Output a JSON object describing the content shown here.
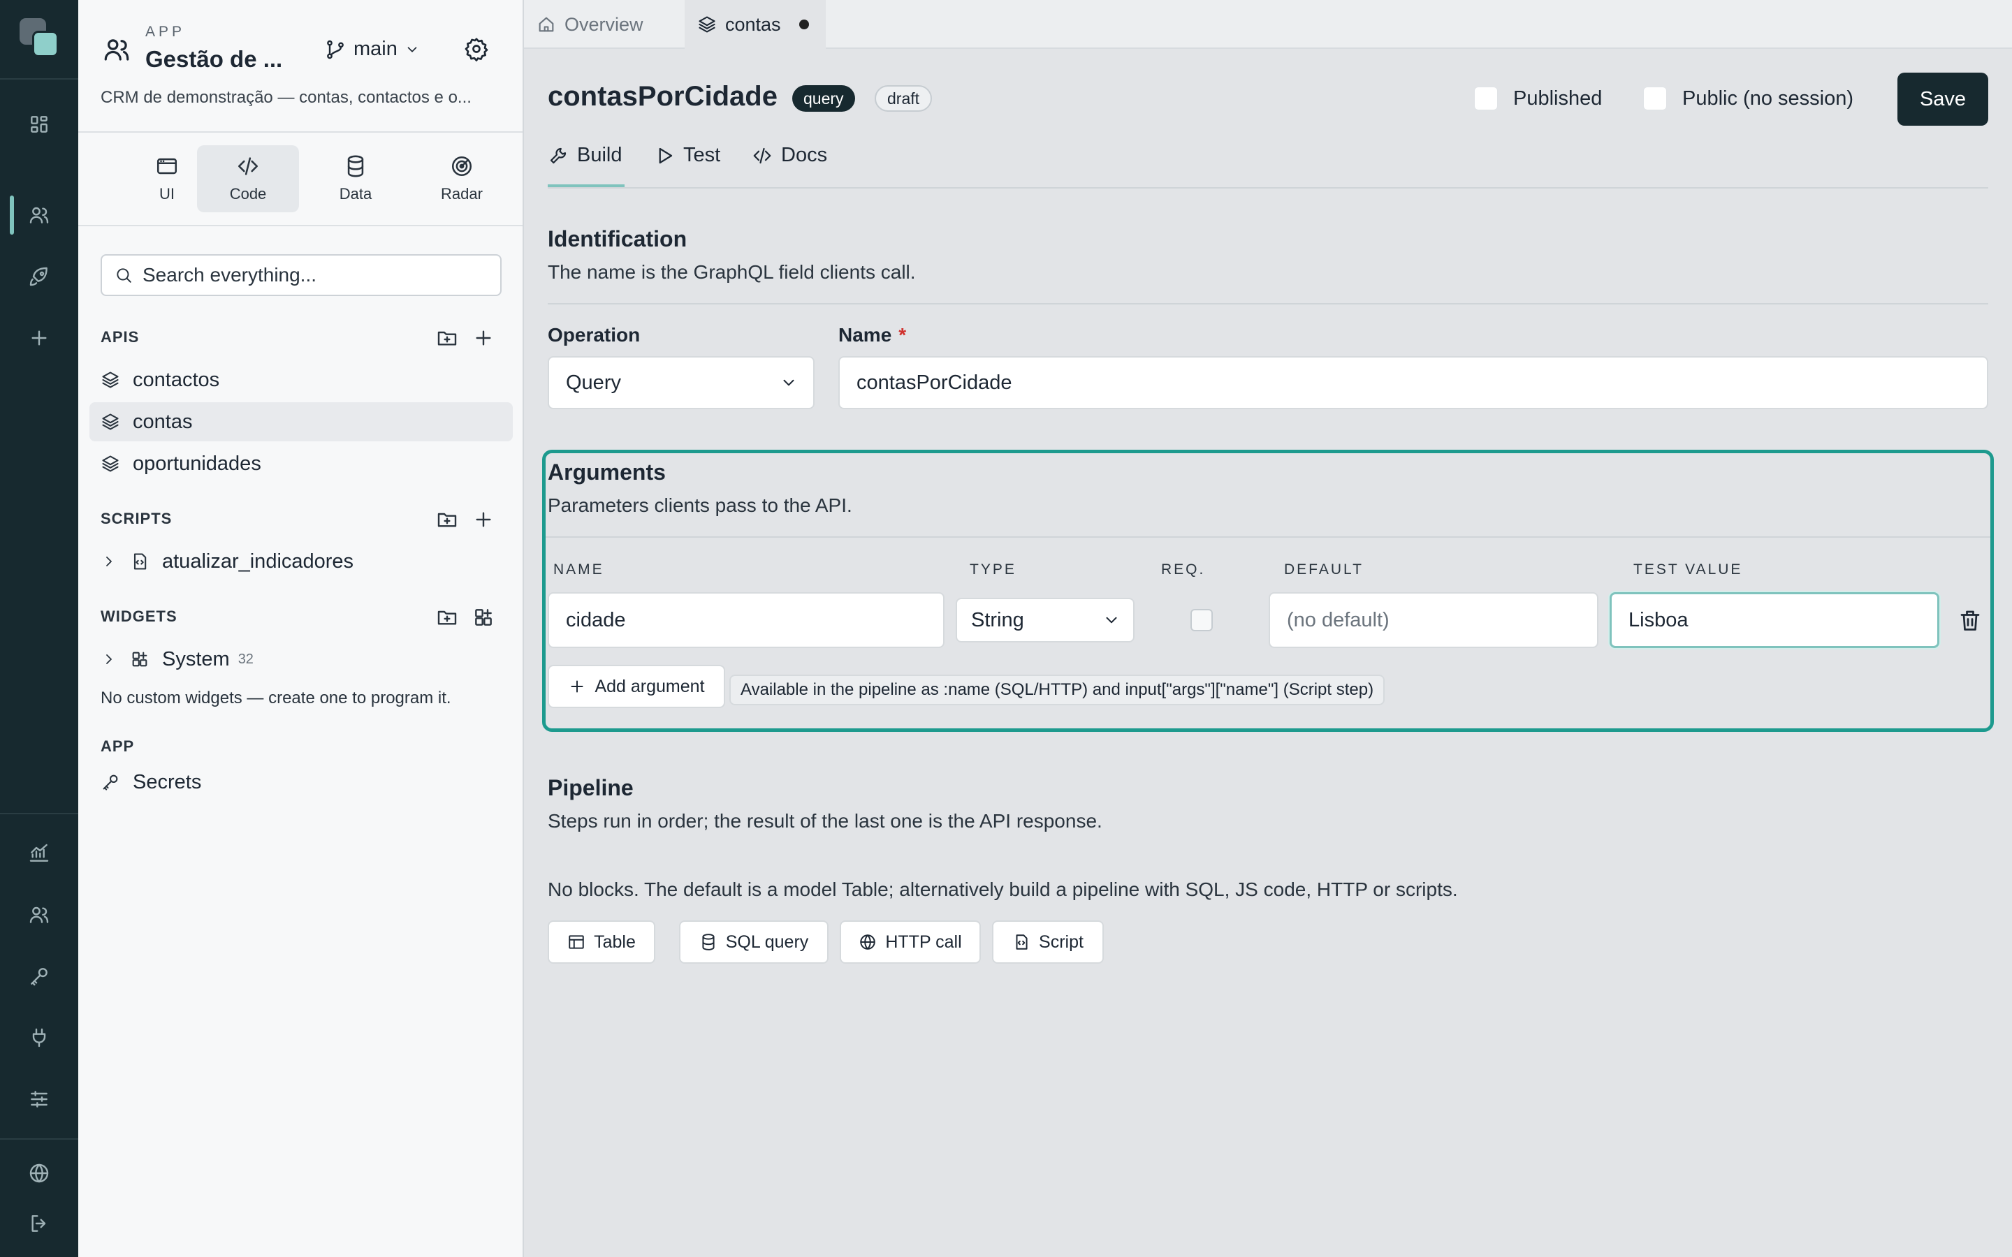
{
  "rail": {
    "items": [
      "apps-icon",
      "users-icon",
      "rocket-icon",
      "plus-icon",
      "analytics-icon",
      "team-icon",
      "key-icon",
      "plug-icon",
      "sliders-icon",
      "globe-icon",
      "logout-icon"
    ]
  },
  "sidebar": {
    "kicker": "APP",
    "app_name": "Gestão de ...",
    "branch": "main",
    "description": "CRM de demonstração — contas, contactos e o...",
    "segments": [
      {
        "label": "UI",
        "icon": "window-icon"
      },
      {
        "label": "Code",
        "icon": "code-icon"
      },
      {
        "label": "Data",
        "icon": "database-icon"
      },
      {
        "label": "Radar",
        "icon": "radar-icon"
      }
    ],
    "search_placeholder": "Search everything...",
    "apis_label": "APIS",
    "apis": [
      "contactos",
      "contas",
      "oportunidades"
    ],
    "scripts_label": "SCRIPTS",
    "scripts": [
      "atualizar_indicadores"
    ],
    "widgets_label": "WIDGETS",
    "widget_group": "System",
    "widget_count": "32",
    "widgets_note": "No custom widgets — create one to program it.",
    "app_label": "APP",
    "secrets": "Secrets"
  },
  "tabs": {
    "overview": "Overview",
    "contas": "contas"
  },
  "header": {
    "title": "contasPorCidade",
    "badge_type": "query",
    "badge_state": "draft",
    "published_label": "Published",
    "public_label": "Public (no session)",
    "save_label": "Save"
  },
  "subtabs": [
    "Build",
    "Test",
    "Docs"
  ],
  "identification": {
    "title": "Identification",
    "subtitle": "The name is the GraphQL field clients call.",
    "operation_label": "Operation",
    "operation_value": "Query",
    "name_label": "Name",
    "name_required": "*",
    "name_value": "contasPorCidade"
  },
  "arguments": {
    "title": "Arguments",
    "subtitle": "Parameters clients pass to the API.",
    "columns": [
      "NAME",
      "TYPE",
      "REQ.",
      "DEFAULT",
      "TEST VALUE"
    ],
    "rows": [
      {
        "name": "cidade",
        "type": "String",
        "required": false,
        "default_placeholder": "(no default)",
        "test_value": "Lisboa"
      }
    ],
    "add_label": "Add argument",
    "hint": "Available in the pipeline as :name (SQL/HTTP) and input[\"args\"][\"name\"] (Script step)"
  },
  "pipeline": {
    "title": "Pipeline",
    "subtitle": "Steps run in order; the result of the last one is the API response.",
    "empty_note": "No blocks. The default is a model Table; alternatively build a pipeline with SQL, JS code, HTTP or scripts.",
    "blocks": [
      "Table",
      "SQL query",
      "HTTP call",
      "Script"
    ]
  }
}
